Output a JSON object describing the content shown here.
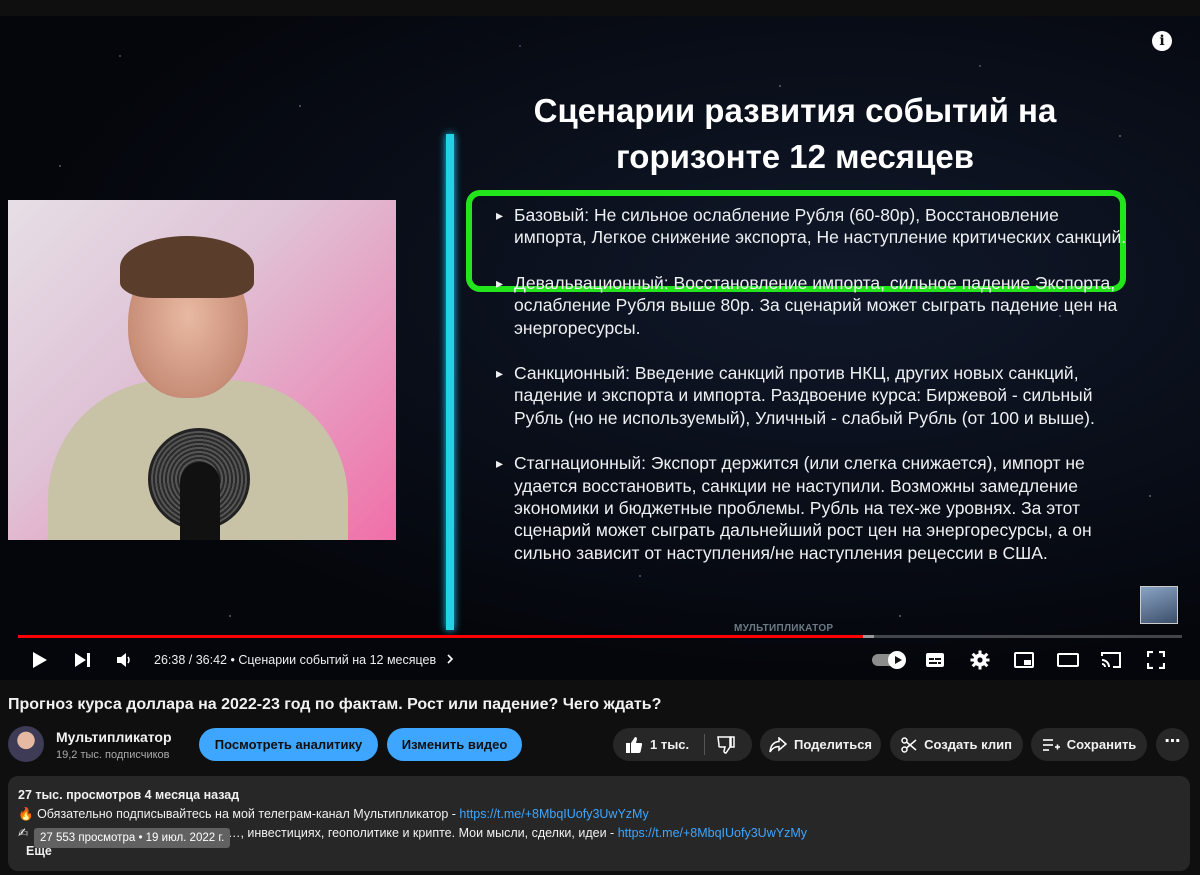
{
  "slide": {
    "title_line1": "Сценарии развития событий на",
    "title_line2": "горизонте 12 месяцев",
    "bullets": [
      "Базовый: Не сильное ослабление Рубля (60-80р), Восстановление импорта, Легкое снижение экспорта, Не наступление критических санкций.",
      "Девальвационный: Восстановление импорта, сильное падение Экспорта, ослабление Рубля выше 80р. За сценарий может сыграть падение цен на энергоресурсы.",
      "Санкционный: Введение санкций против НКЦ, других новых санкций, падение и экспорта и импорта. Раздвоение курса: Биржевой - сильный Рубль (но не используемый), Уличный - слабый Рубль (от 100 и выше).",
      "Стагнационный: Экспорт держится (или слегка снижается), импорт не удается восстановить, санкции не наступили. Возможны замедление экономики и бюджетные проблемы. Рубль на тех-же уровнях. За этот сценарий может сыграть дальнейший рост цен на энергоресурсы, а он сильно зависит от наступления/не наступления рецессии в США."
    ],
    "watermark": "МУЛЬТИПЛИКАТОР",
    "info_icon": "i"
  },
  "player": {
    "current_time": "26:38",
    "duration": "36:42",
    "time_display": "26:38 / 36:42",
    "separator": "•",
    "chapter": "Сценарии событий на 12 месяцев",
    "played_fraction": 0.726,
    "buffered_fraction": 0.735,
    "accent_color": "#ff0000"
  },
  "video": {
    "title": "Прогноз курса доллара на 2022-23 год по фактам. Рост или падение? Чего ждать?"
  },
  "channel": {
    "name": "Мультипликатор",
    "subscribers": "19,2 тыс. подписчиков"
  },
  "actions": {
    "analytics": "Посмотреть аналитику",
    "edit": "Изменить видео",
    "likes": "1 тыс.",
    "share": "Поделиться",
    "clip": "Создать клип",
    "save": "Сохранить",
    "more": "⋯"
  },
  "description": {
    "meta": "27 тыс. просмотров  4 месяца назад",
    "line1_emoji": "🔥",
    "line1_text": "Обязательно подписывайтесь на мой телеграм-канал Мультипликатор - ",
    "line1_link": "https://t.me/+8MbqIUofy3UwYzMy",
    "line2_emoji": "✍",
    "line2_text": "…, инвестициях, геополитике и крипте. Мои мысли, сделки, идеи - ",
    "line2_link": "https://t.me/+8MbqIUofy3UwYzMy",
    "more": "Ещё",
    "tooltip": "27 553 просмотра • 19 июл. 2022 г."
  }
}
